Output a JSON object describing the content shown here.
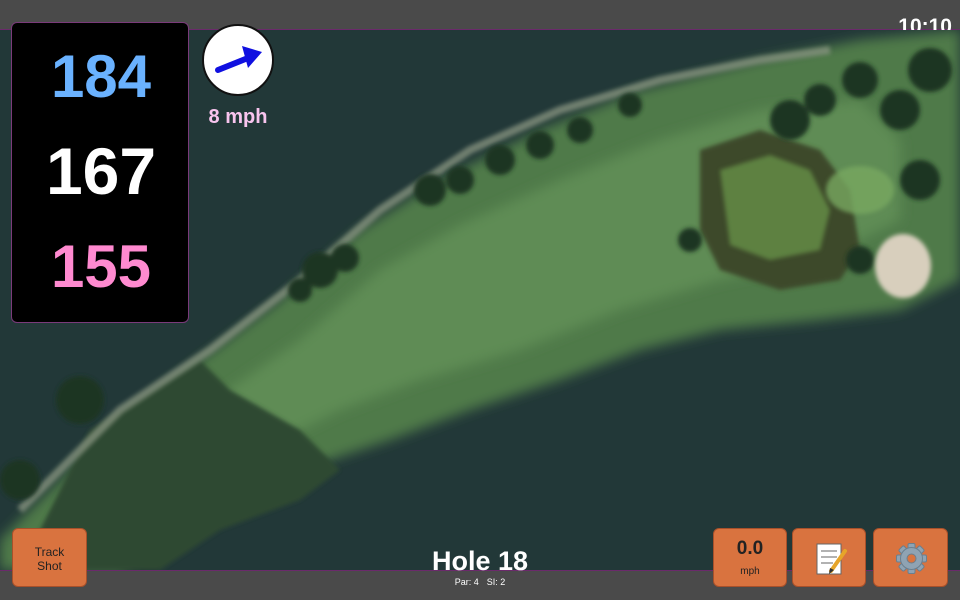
{
  "status": {
    "time": "10:10"
  },
  "yardages": {
    "back": "184",
    "middle": "167",
    "front": "155"
  },
  "wind": {
    "speed": "8 mph",
    "direction_icon": "arrow-up-right-icon"
  },
  "hole": {
    "title": "Hole 18",
    "par": "Par: 4",
    "si": "SI: 2"
  },
  "buttons": {
    "track_shot": "Track\nShot",
    "track_shot_line1": "Track",
    "track_shot_line2": "Shot",
    "speed_value": "0.0",
    "speed_unit": "mph",
    "notes_icon": "memo-icon",
    "settings_icon": "gear-icon"
  },
  "colors": {
    "back_yardage": "#6ab2ff",
    "middle_yardage": "#ffffff",
    "front_yardage": "#ff8ad0",
    "button_bg": "#d9733f",
    "wind_text": "#f8c4ee"
  }
}
